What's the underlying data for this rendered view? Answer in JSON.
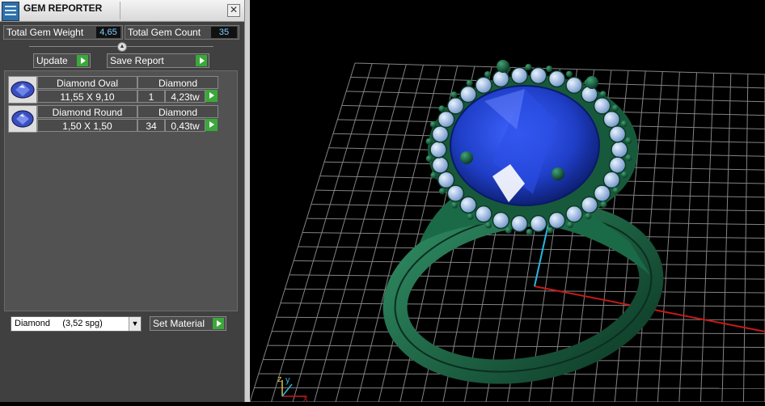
{
  "window": {
    "title": "GEM REPORTER"
  },
  "stats": {
    "total_weight_label": "Total Gem Weight",
    "total_weight_value": "4,65",
    "total_count_label": "Total Gem Count",
    "total_count_value": "35"
  },
  "toolbar": {
    "update_label": "Update",
    "save_report_label": "Save Report"
  },
  "gems": [
    {
      "name": "Diamond Oval",
      "material": "Diamond",
      "size": "11,55 X 9,10",
      "count": "1",
      "weight": "4,23tw",
      "icon": "oval-gem-icon"
    },
    {
      "name": "Diamond Round",
      "material": "Diamond",
      "size": "1,50 X 1,50",
      "count": "34",
      "weight": "0,43tw",
      "icon": "round-gem-icon"
    }
  ],
  "material_select": {
    "value": "Diamond     (3,52 spg)"
  },
  "set_material": {
    "label": "Set Material"
  },
  "viewport": {
    "axis_x": "x",
    "axis_y": "y",
    "axis_z": "z"
  },
  "colors": {
    "accent_green": "#3aa83a",
    "value_text": "#7ad0ff",
    "ring_metal": "#1f6b4a",
    "center_stone": "#1f3fc8",
    "side_stones": "#9fc4f0"
  }
}
